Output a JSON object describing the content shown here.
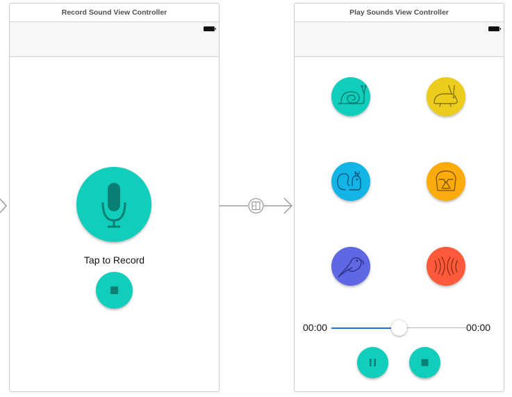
{
  "record_scene": {
    "title": "Record Sound View Controller",
    "record_label": "Tap to Record",
    "record_button_icon": "microphone-icon",
    "stop_button_icon": "stop-icon"
  },
  "play_scene": {
    "title": "Play Sounds View Controller",
    "effects": [
      {
        "icon": "snail-icon",
        "color": "#11cdbb"
      },
      {
        "icon": "rabbit-icon",
        "color": "#eccc1c"
      },
      {
        "icon": "chipmunk-icon",
        "color": "#14b4e6"
      },
      {
        "icon": "darth-vader-icon",
        "color": "#fcab0c"
      },
      {
        "icon": "parrot-icon",
        "color": "#5f67e2"
      },
      {
        "icon": "echo-icon",
        "color": "#fd5a3b"
      }
    ],
    "current_time": "00:00",
    "total_time": "00:00",
    "progress": 0.5,
    "pause_icon": "pause-icon",
    "stop_icon": "stop-icon"
  },
  "colors": {
    "accent": "#11cdbb",
    "icon_dark": "#0a8075",
    "slider_fill": "#1a74e0"
  }
}
